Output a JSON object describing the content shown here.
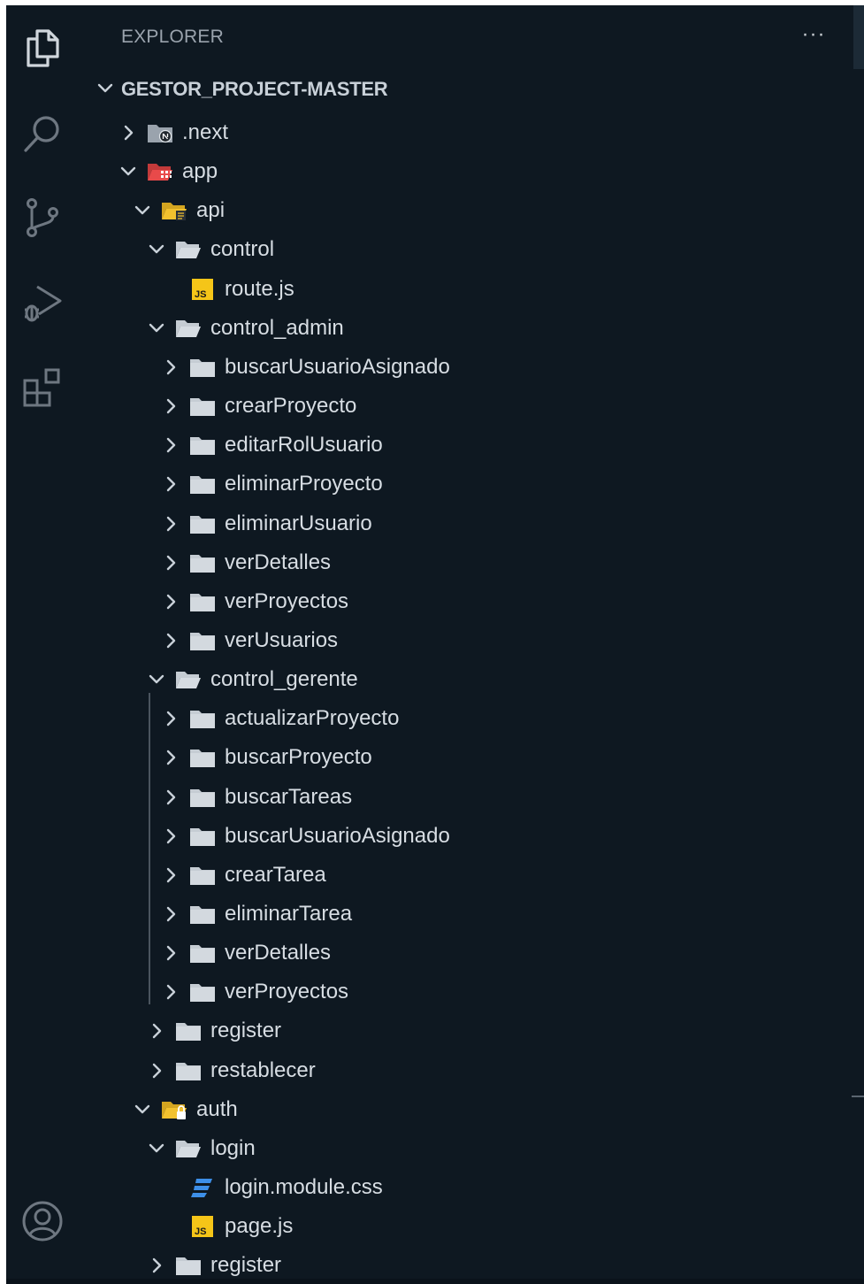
{
  "sidebar": {
    "title": "EXPLORER",
    "more_label": "···",
    "root": "GESTOR_PROJECT-MASTER"
  },
  "tree": [
    {
      "label": ".next",
      "level": 0,
      "expanded": false,
      "type": "folder",
      "icon": "next-folder-icon"
    },
    {
      "label": "app",
      "level": 0,
      "expanded": true,
      "type": "folder",
      "icon": "app-folder-icon"
    },
    {
      "label": "api",
      "level": 1,
      "expanded": true,
      "type": "folder",
      "icon": "api-folder-icon"
    },
    {
      "label": "control",
      "level": 2,
      "expanded": true,
      "type": "folder",
      "icon": "folder-open-icon"
    },
    {
      "label": "route.js",
      "level": 3,
      "type": "file",
      "icon": "js-file-icon"
    },
    {
      "label": "control_admin",
      "level": 2,
      "expanded": true,
      "type": "folder",
      "icon": "folder-open-icon"
    },
    {
      "label": "buscarUsuarioAsignado",
      "level": 3,
      "expanded": false,
      "type": "folder",
      "icon": "folder-icon"
    },
    {
      "label": "crearProyecto",
      "level": 3,
      "expanded": false,
      "type": "folder",
      "icon": "folder-icon"
    },
    {
      "label": "editarRolUsuario",
      "level": 3,
      "expanded": false,
      "type": "folder",
      "icon": "folder-icon"
    },
    {
      "label": "eliminarProyecto",
      "level": 3,
      "expanded": false,
      "type": "folder",
      "icon": "folder-icon"
    },
    {
      "label": "eliminarUsuario",
      "level": 3,
      "expanded": false,
      "type": "folder",
      "icon": "folder-icon"
    },
    {
      "label": "verDetalles",
      "level": 3,
      "expanded": false,
      "type": "folder",
      "icon": "folder-icon"
    },
    {
      "label": "verProyectos",
      "level": 3,
      "expanded": false,
      "type": "folder",
      "icon": "folder-icon"
    },
    {
      "label": "verUsuarios",
      "level": 3,
      "expanded": false,
      "type": "folder",
      "icon": "folder-icon"
    },
    {
      "label": "control_gerente",
      "level": 2,
      "expanded": true,
      "type": "folder",
      "icon": "folder-open-icon"
    },
    {
      "label": "actualizarProyecto",
      "level": 3,
      "expanded": false,
      "type": "folder",
      "icon": "folder-icon"
    },
    {
      "label": "buscarProyecto",
      "level": 3,
      "expanded": false,
      "type": "folder",
      "icon": "folder-icon"
    },
    {
      "label": "buscarTareas",
      "level": 3,
      "expanded": false,
      "type": "folder",
      "icon": "folder-icon"
    },
    {
      "label": "buscarUsuarioAsignado",
      "level": 3,
      "expanded": false,
      "type": "folder",
      "icon": "folder-icon"
    },
    {
      "label": "crearTarea",
      "level": 3,
      "expanded": false,
      "type": "folder",
      "icon": "folder-icon"
    },
    {
      "label": "eliminarTarea",
      "level": 3,
      "expanded": false,
      "type": "folder",
      "icon": "folder-icon"
    },
    {
      "label": "verDetalles",
      "level": 3,
      "expanded": false,
      "type": "folder",
      "icon": "folder-icon"
    },
    {
      "label": "verProyectos",
      "level": 3,
      "expanded": false,
      "type": "folder",
      "icon": "folder-icon"
    },
    {
      "label": "register",
      "level": 2,
      "expanded": false,
      "type": "folder",
      "icon": "folder-icon"
    },
    {
      "label": "restablecer",
      "level": 2,
      "expanded": false,
      "type": "folder",
      "icon": "folder-icon"
    },
    {
      "label": "auth",
      "level": 1,
      "expanded": true,
      "type": "folder",
      "icon": "auth-folder-icon"
    },
    {
      "label": "login",
      "level": 2,
      "expanded": true,
      "type": "folder",
      "icon": "folder-open-icon"
    },
    {
      "label": "login.module.css",
      "level": 3,
      "type": "file",
      "icon": "css-file-icon"
    },
    {
      "label": "page.js",
      "level": 3,
      "type": "file",
      "icon": "js-file-icon"
    },
    {
      "label": "register",
      "level": 2,
      "expanded": false,
      "type": "folder",
      "icon": "folder-icon"
    }
  ],
  "activity_bar": [
    "explorer-icon",
    "search-icon",
    "source-control-icon",
    "run-debug-icon",
    "extensions-icon",
    "account-icon"
  ],
  "colors": {
    "background": "#0e1821",
    "text": "#d7dde3",
    "header_text": "#9aa3ad",
    "folder": "#c5ccd3",
    "js_badge": "#f5c518",
    "css_icon": "#3d8fe8",
    "app_folder": "#e84a4a",
    "api_folder": "#f2c12e"
  }
}
